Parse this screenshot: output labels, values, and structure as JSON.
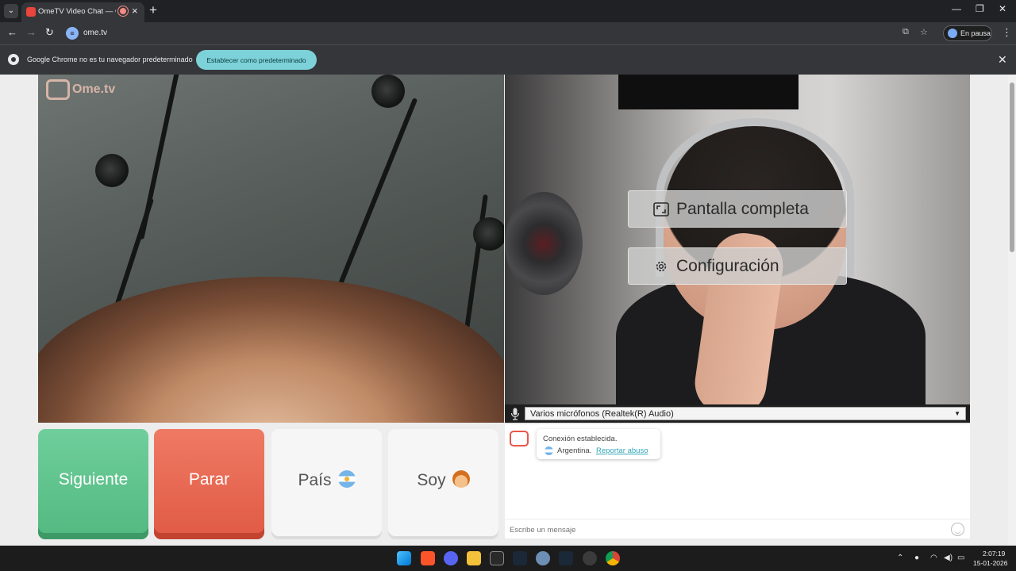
{
  "browser": {
    "tab_title": "OmeTV Video Chat — Ome",
    "url": "ome.tv",
    "profile_label": "En pausa",
    "infobar_message": "Google Chrome no es tu navegador predeterminado",
    "infobar_button": "Establecer como predeterminado"
  },
  "video": {
    "logo_text": "Ome.tv",
    "overlay_fullscreen": "Pantalla completa",
    "overlay_settings": "Configuración",
    "mic_selected": "Varios micrófonos (Realtek(R) Audio)"
  },
  "controls": {
    "next_label": "Siguiente",
    "stop_label": "Parar",
    "country_label": "País",
    "soy_label": "Soy",
    "next_color": "#5fc48d",
    "stop_color": "#e86650"
  },
  "chat": {
    "status": "Conexión establecida.",
    "country": "Argentina.",
    "report_link": "Reportar abuso",
    "input_placeholder": "Escribe un mensaje"
  },
  "taskbar": {
    "time": "2:07:19",
    "date": "15-01-2026"
  }
}
